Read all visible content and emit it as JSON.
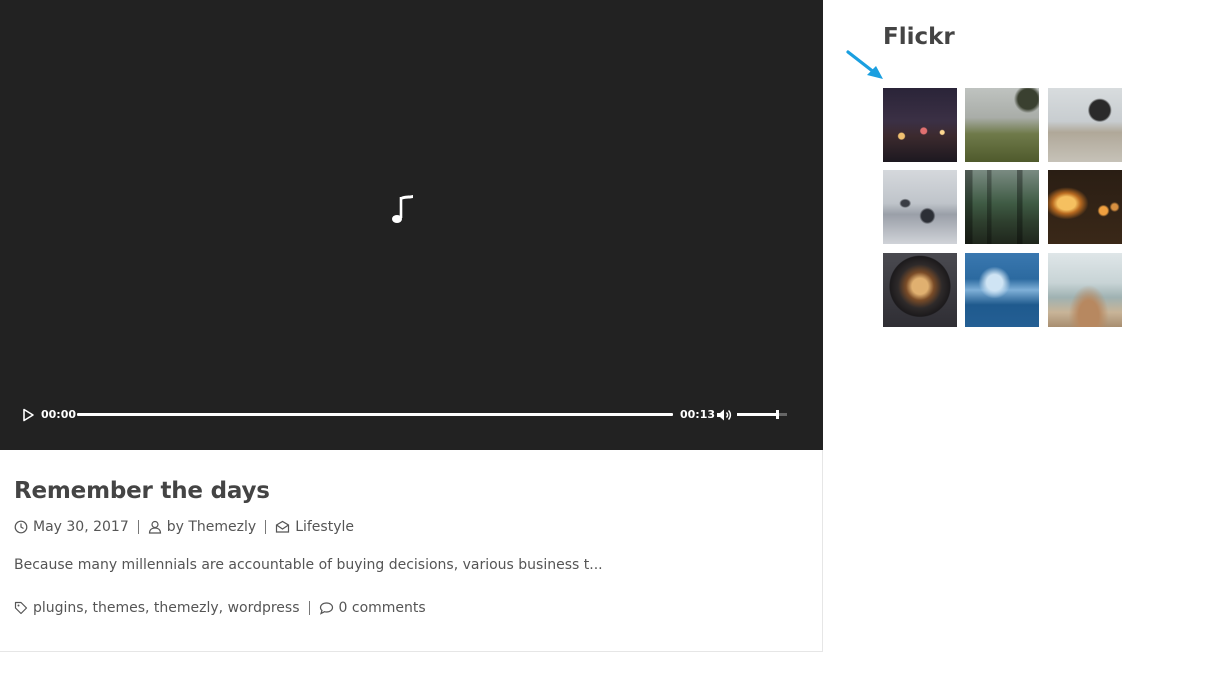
{
  "player": {
    "current_time": "00:00",
    "duration": "00:13",
    "progress": 0,
    "volume": 0.8,
    "icons": [
      "music-note-icon",
      "play-icon",
      "volume-icon"
    ]
  },
  "post": {
    "title": "Remember the days",
    "date": "May 30, 2017",
    "author": "by Themezly",
    "category": "Lifestyle",
    "excerpt": "Because many millennials are accountable of buying decisions, various business t...",
    "tags": "plugins, themes, themezly, wordpress",
    "comments": "0 comments"
  },
  "sidebar": {
    "widget_title": "Flickr",
    "annotation_color": "#1a9fe0",
    "thumbnails": [
      {
        "name": "city-lights-bokeh"
      },
      {
        "name": "foggy-field-tree"
      },
      {
        "name": "motorcycle-on-beach"
      },
      {
        "name": "misty-rocks-sea"
      },
      {
        "name": "forest-sunlight"
      },
      {
        "name": "edison-bulb"
      },
      {
        "name": "lens-light"
      },
      {
        "name": "ocean-wave"
      },
      {
        "name": "hazy-grass"
      }
    ]
  }
}
